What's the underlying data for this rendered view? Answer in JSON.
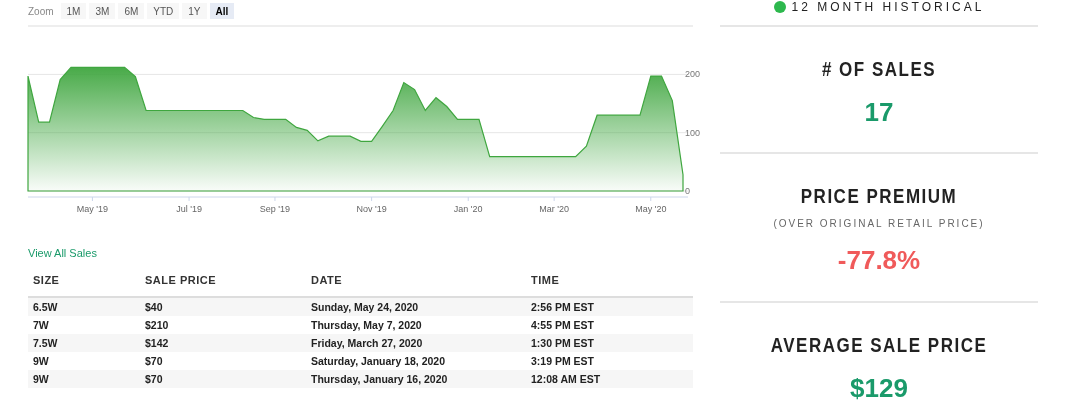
{
  "zoom": {
    "label": "Zoom",
    "options": [
      {
        "label": "1M",
        "selected": false
      },
      {
        "label": "3M",
        "selected": false
      },
      {
        "label": "6M",
        "selected": false
      },
      {
        "label": "YTD",
        "selected": false
      },
      {
        "label": "1Y",
        "selected": false
      },
      {
        "label": "All",
        "selected": true
      }
    ]
  },
  "chart": {
    "chart_data": {
      "type": "area",
      "categories": [
        null,
        null,
        null,
        null,
        null,
        null,
        "May '19",
        null,
        null,
        null,
        null,
        null,
        null,
        null,
        null,
        "Jul '19",
        null,
        null,
        null,
        null,
        null,
        null,
        null,
        "Sep '19",
        null,
        null,
        null,
        null,
        null,
        null,
        null,
        null,
        "Nov '19",
        null,
        null,
        null,
        null,
        null,
        null,
        null,
        null,
        "Jan '20",
        null,
        null,
        null,
        null,
        null,
        null,
        null,
        "Mar '20",
        null,
        null,
        null,
        null,
        null,
        null,
        null,
        null,
        "May '20",
        null,
        null,
        null
      ],
      "series": [
        {
          "color": "#3fa63f",
          "values": [
            197,
            118,
            118,
            191,
            212,
            212,
            212,
            212,
            212,
            212,
            196,
            138,
            138,
            138,
            138,
            138,
            138,
            138,
            138,
            138,
            138,
            126,
            123,
            123,
            123,
            109,
            104,
            86,
            94,
            94,
            94,
            85,
            85,
            111,
            138,
            186,
            174,
            138,
            160,
            145,
            123,
            123,
            123,
            59,
            59,
            59,
            59,
            59,
            59,
            59,
            59,
            59,
            77,
            130,
            130,
            130,
            130,
            130,
            197,
            197,
            155,
            28
          ]
        }
      ],
      "ylim": [
        0,
        283
      ],
      "yticks": [
        0,
        100,
        200
      ]
    }
  },
  "sales_link": "View All Sales",
  "table": {
    "columns": [
      "SIZE",
      "SALE PRICE",
      "DATE",
      "TIME"
    ],
    "rows": [
      [
        "6.5W",
        "$40",
        "Sunday, May 24, 2020",
        "2:56 PM EST"
      ],
      [
        "7W",
        "$210",
        "Thursday, May 7, 2020",
        "4:55 PM EST"
      ],
      [
        "7.5W",
        "$142",
        "Friday, March 27, 2020",
        "1:30 PM EST"
      ],
      [
        "9W",
        "$70",
        "Saturday, January 18, 2020",
        "3:19 PM EST"
      ],
      [
        "9W",
        "$70",
        "Thursday, January 16, 2020",
        "12:08 AM EST"
      ]
    ]
  },
  "sidebar": {
    "header": "12 MONTH HISTORICAL",
    "stats": [
      {
        "title": "# OF SALES",
        "value": "17",
        "color": "#1a9a6a"
      },
      {
        "title": "PRICE PREMIUM",
        "subtitle": "(OVER ORIGINAL RETAIL PRICE)",
        "value": "-77.8%",
        "color": "#f05a5a"
      },
      {
        "title": "AVERAGE SALE PRICE",
        "value": "$129",
        "color": "#1a9a6a"
      }
    ]
  }
}
